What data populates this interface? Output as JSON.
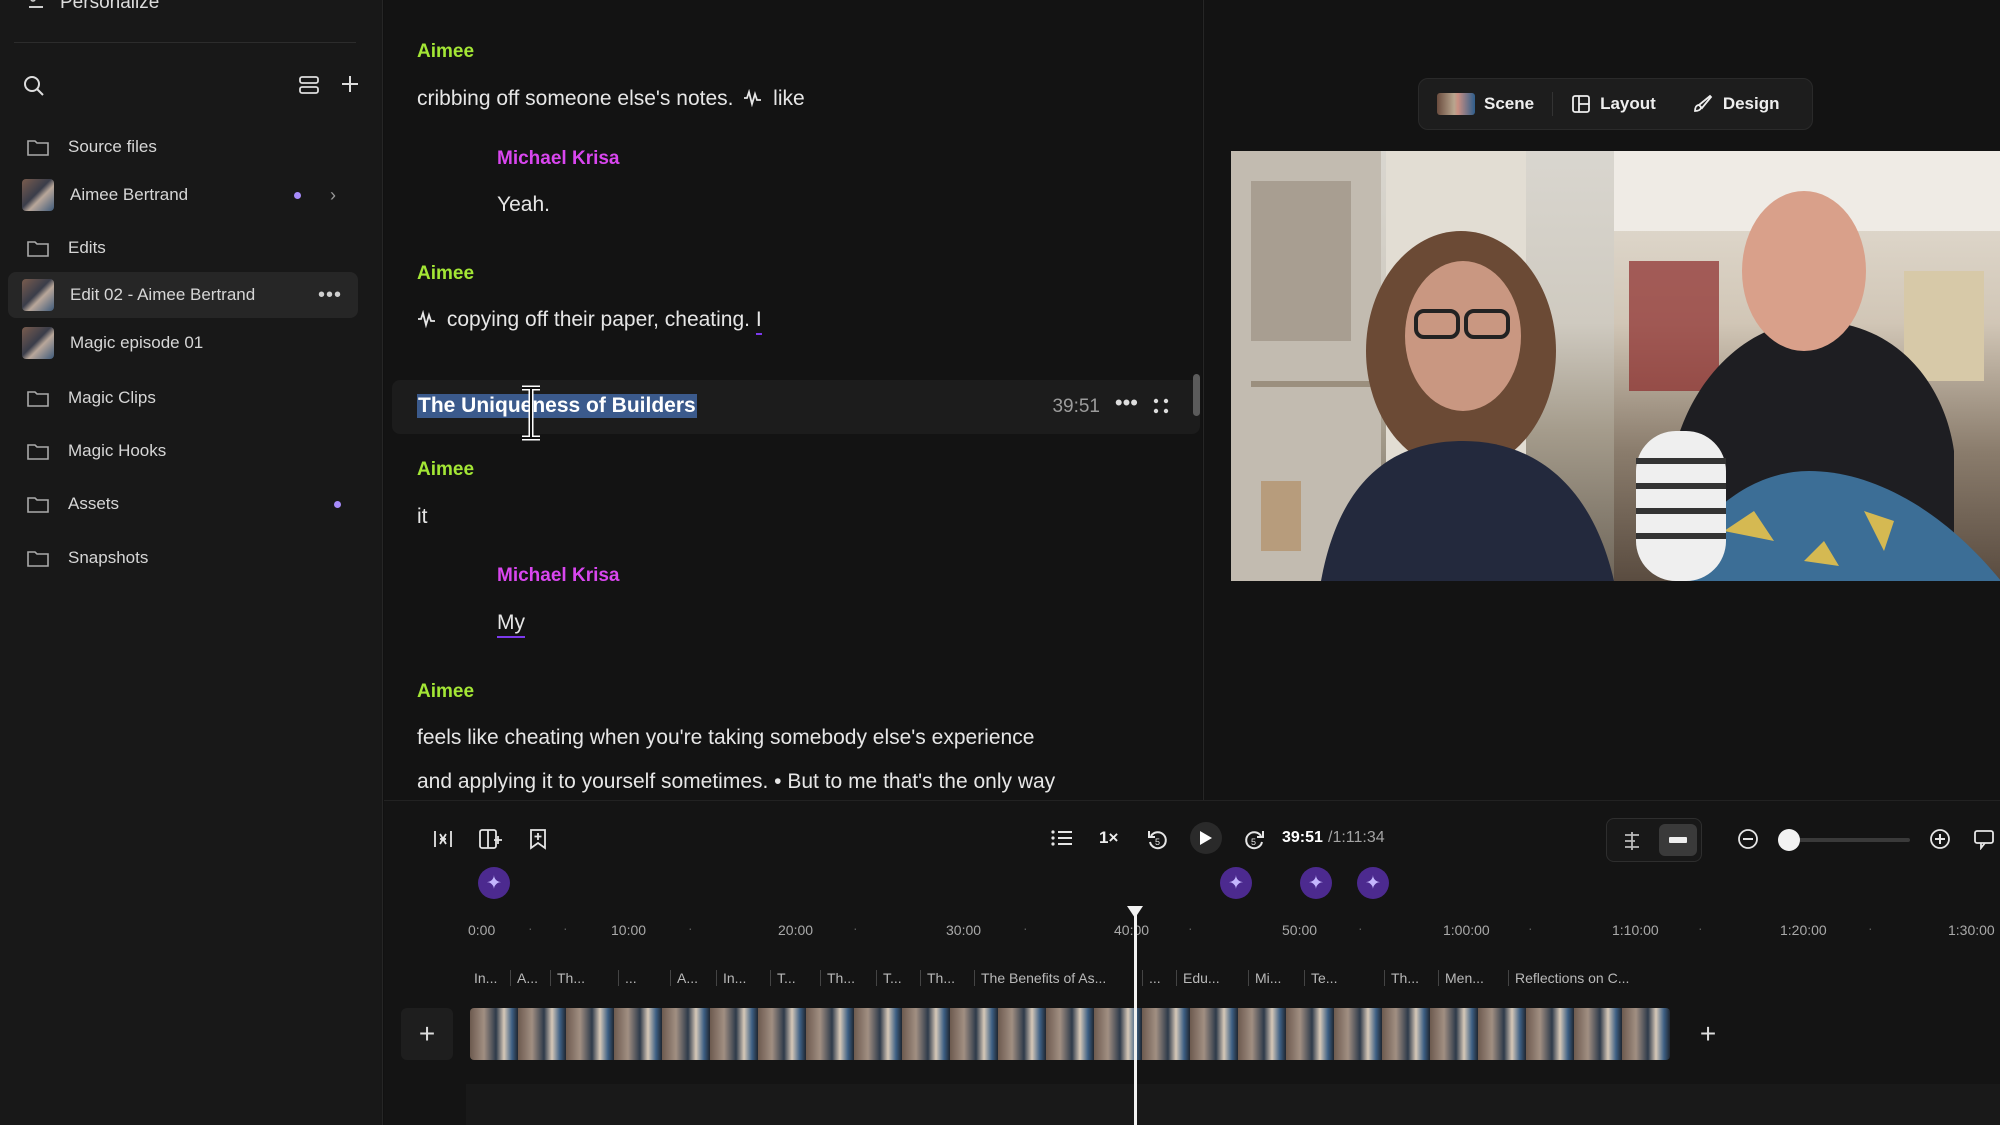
{
  "sidebar": {
    "top_label": "Personalize",
    "items": [
      {
        "label": "Source files"
      },
      {
        "label": "Aimee Bertrand"
      },
      {
        "label": "Edits"
      },
      {
        "label": "Edit 02 - Aimee Bertrand"
      },
      {
        "label": "Magic episode 01"
      },
      {
        "label": "Magic Clips"
      },
      {
        "label": "Magic Hooks"
      },
      {
        "label": "Assets"
      },
      {
        "label": "Snapshots"
      }
    ]
  },
  "transcript": {
    "blocks": [
      {
        "speaker": "Aimee",
        "text_before": "cribbing off someone else's notes.",
        "text_after": "like"
      },
      {
        "speaker": "Michael Krisa",
        "text": "Yeah."
      },
      {
        "speaker": "Aimee",
        "text": "copying off their paper, cheating.",
        "tail": "I"
      },
      {
        "speaker": "Aimee",
        "text": "it"
      },
      {
        "speaker": "Michael Krisa",
        "text": "My"
      },
      {
        "speaker": "Aimee",
        "line1": "feels like cheating when you're taking somebody else's experience",
        "line2": "and applying it to yourself sometimes. • But to me that's the only way"
      }
    ],
    "chapter": {
      "title": "The Uniqueness of Builders",
      "time": "39:51"
    }
  },
  "toolbar": {
    "scene": "Scene",
    "layout": "Layout",
    "design": "Design"
  },
  "playback": {
    "speed": "1×",
    "current_time": "39:51",
    "total_time": "/1:11:34",
    "zoom_level": 0.0
  },
  "timeline": {
    "ruler": [
      "0:00",
      "10:00",
      "20:00",
      "30:00",
      "40:00",
      "50:00",
      "1:00:00",
      "1:10:00",
      "1:20:00",
      "1:30:00"
    ],
    "chapters": [
      "In...",
      "A...",
      "Th...",
      "...",
      "A...",
      "In...",
      "T...",
      "Th...",
      "T...",
      "Th...",
      "The Benefits of As...",
      "...",
      "Edu...",
      "Mi...",
      "Te...",
      "Th...",
      "Men...",
      "Reflections on C..."
    ]
  },
  "colors": {
    "speaker_aimee": "#a3e635",
    "speaker_michael": "#d946ef",
    "accent": "#7c3aed"
  }
}
